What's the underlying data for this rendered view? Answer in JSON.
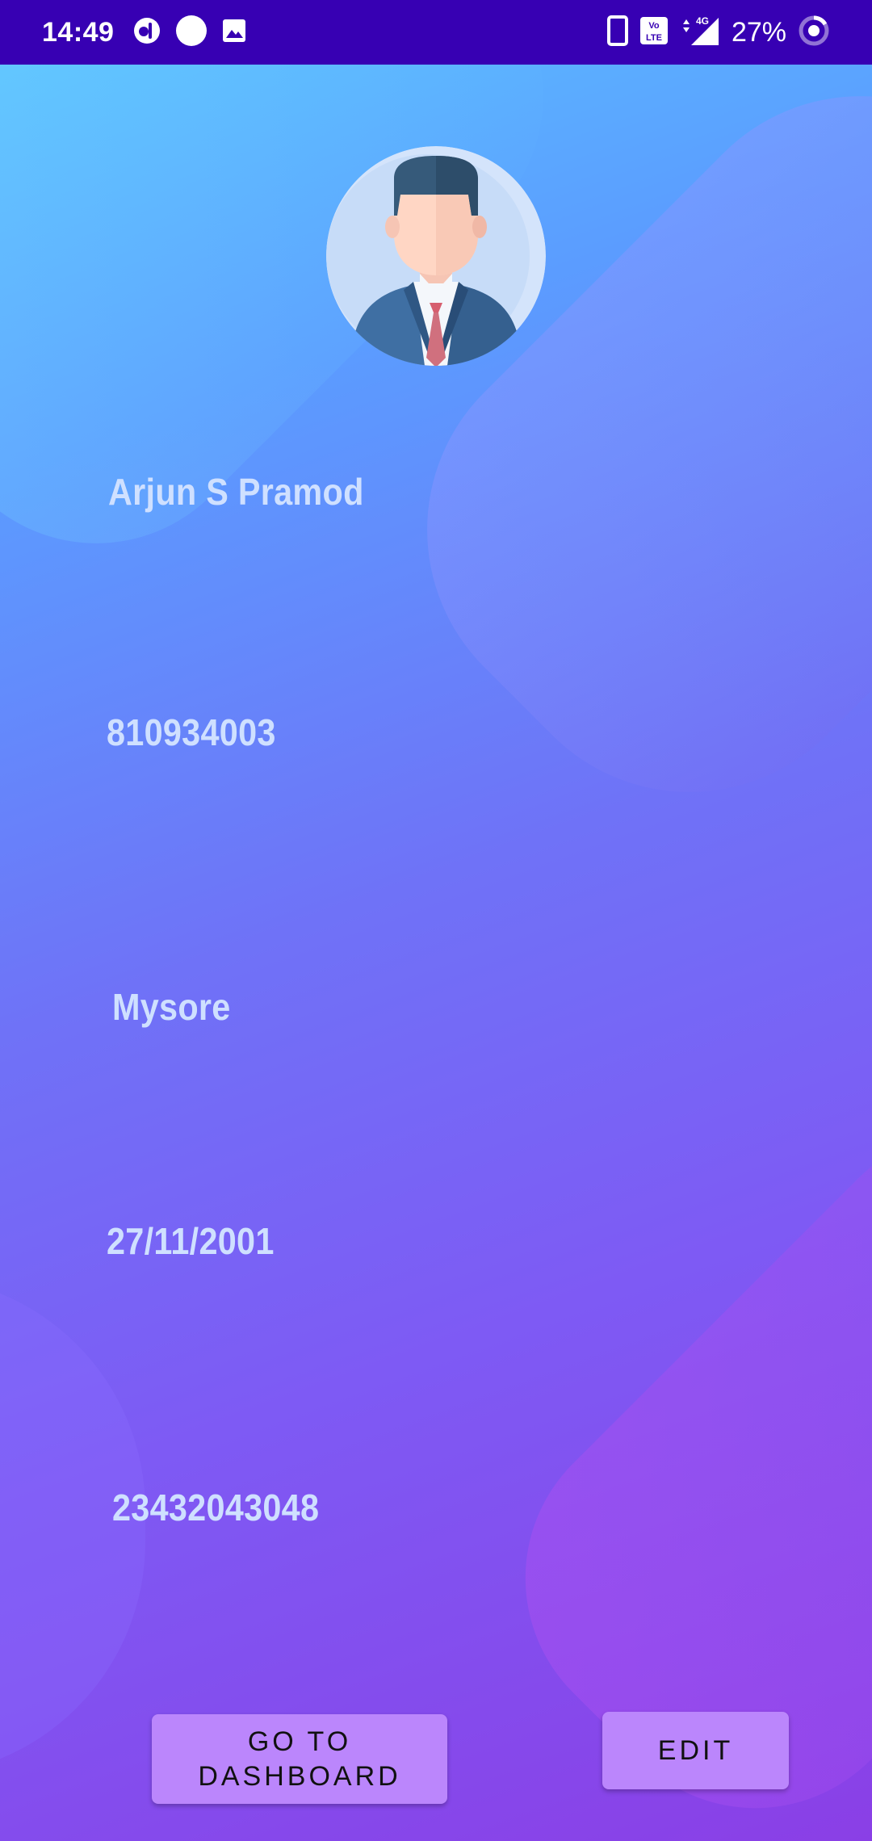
{
  "status_bar": {
    "time": "14:49",
    "battery_percent": "27%",
    "left_icons": [
      "notification-app-icon",
      "dot-icon",
      "image-icon"
    ],
    "right_icons": [
      "phone-icon",
      "volte-icon",
      "signal-4g-icon",
      "battery-ring-icon"
    ],
    "background_color": "#3700b3"
  },
  "profile": {
    "avatar_icon": "businessman-avatar-icon",
    "name": "Arjun S Pramod",
    "phone": "810934003",
    "city": "Mysore",
    "dob": "27/11/2001",
    "id_number": "23432043048"
  },
  "actions": {
    "dashboard_label": "GO TO DASHBOARD",
    "edit_label": "EDIT",
    "button_color": "#bb86fc"
  },
  "colors": {
    "gradient_top": "#5bc6ff",
    "gradient_bottom": "#8a3fe6",
    "field_text": "#cfe0ff"
  }
}
